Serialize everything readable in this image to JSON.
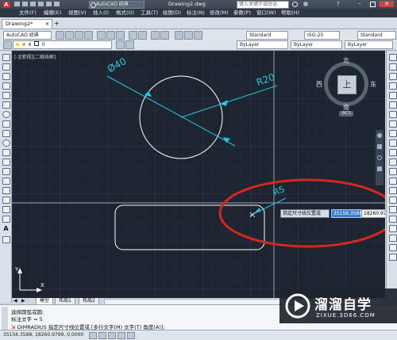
{
  "app": {
    "product_label": "AutoCAD 经典",
    "file_title": "Drawing2.dwg",
    "search_placeholder": "键入关键字或短语",
    "menu": [
      "文件(F)",
      "编辑(E)",
      "视图(V)",
      "插入(I)",
      "格式(O)",
      "工具(T)",
      "绘图(D)",
      "标注(N)",
      "修改(M)",
      "参数(P)",
      "窗口(W)",
      "帮助(H)"
    ]
  },
  "tabs": {
    "document": "Drawing2*"
  },
  "toolbar": {
    "workspace": "AutoCAD 经典",
    "layer": "0",
    "text_style": "Standard",
    "dim_style": "ISO-25",
    "table_style": "Standard",
    "color": "ByLayer",
    "linetype": "ByLayer",
    "lineweight": "ByLayer"
  },
  "viewport": {
    "label": "[-][俯视][二维线框]"
  },
  "drawing": {
    "circle_dim": "Ø40",
    "radius_dim": "R20",
    "fillet_dim": "R5",
    "tooltip_label": "指定尺寸线位置或",
    "coord_x": "35156.3588",
    "coord_y": "18260.9799"
  },
  "viewcube": {
    "north": "北",
    "south": "南",
    "east": "东",
    "west": "西",
    "face": "上",
    "wcs": "WCS"
  },
  "layout_tabs": [
    "模型",
    "布局1",
    "布局2"
  ],
  "command_lines": [
    "选择圆弧或圆:",
    "标注文字 = 5",
    "DIMRADIUS 指定尺寸线位置或 [多行文字(M) 文字(T) 角度(A)]:"
  ],
  "status_coords": "35156.3588, 18260.9799, 0.0000",
  "watermark": {
    "name": "溜溜自学",
    "url": "ZIXUE.3D66.COM"
  },
  "colors": {
    "canvas": "#1d2531",
    "geometry": "#ffffff",
    "dimension": "#27c6e6",
    "annotation_ellipse": "#d8261d",
    "crosshair": "#9aa3ad"
  }
}
